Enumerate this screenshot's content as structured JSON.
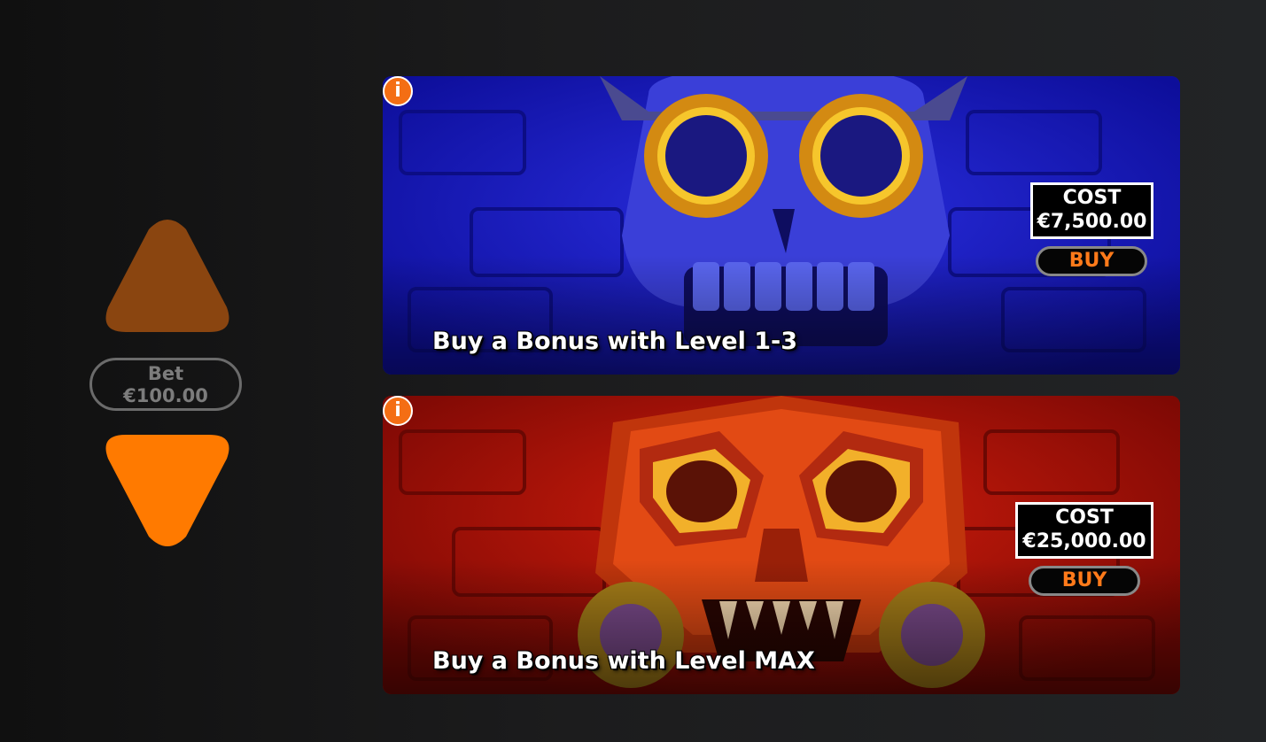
{
  "bet": {
    "label": "Bet",
    "value": "€100.00",
    "increase_icon": "triangle-up-icon",
    "decrease_icon": "triangle-down-icon",
    "increase_color": "#8a4510",
    "decrease_color": "#ff7a00"
  },
  "bonuses": [
    {
      "title": "Buy a Bonus with Level 1-3",
      "cost_label": "COST",
      "cost_value": "€7,500.00",
      "buy_label": "BUY",
      "info_icon": "i",
      "theme_color": "#1314b8"
    },
    {
      "title": "Buy a Bonus with Level MAX",
      "cost_label": "COST",
      "cost_value": "€25,000.00",
      "buy_label": "BUY",
      "info_icon": "i",
      "theme_color": "#8e0c06"
    }
  ]
}
